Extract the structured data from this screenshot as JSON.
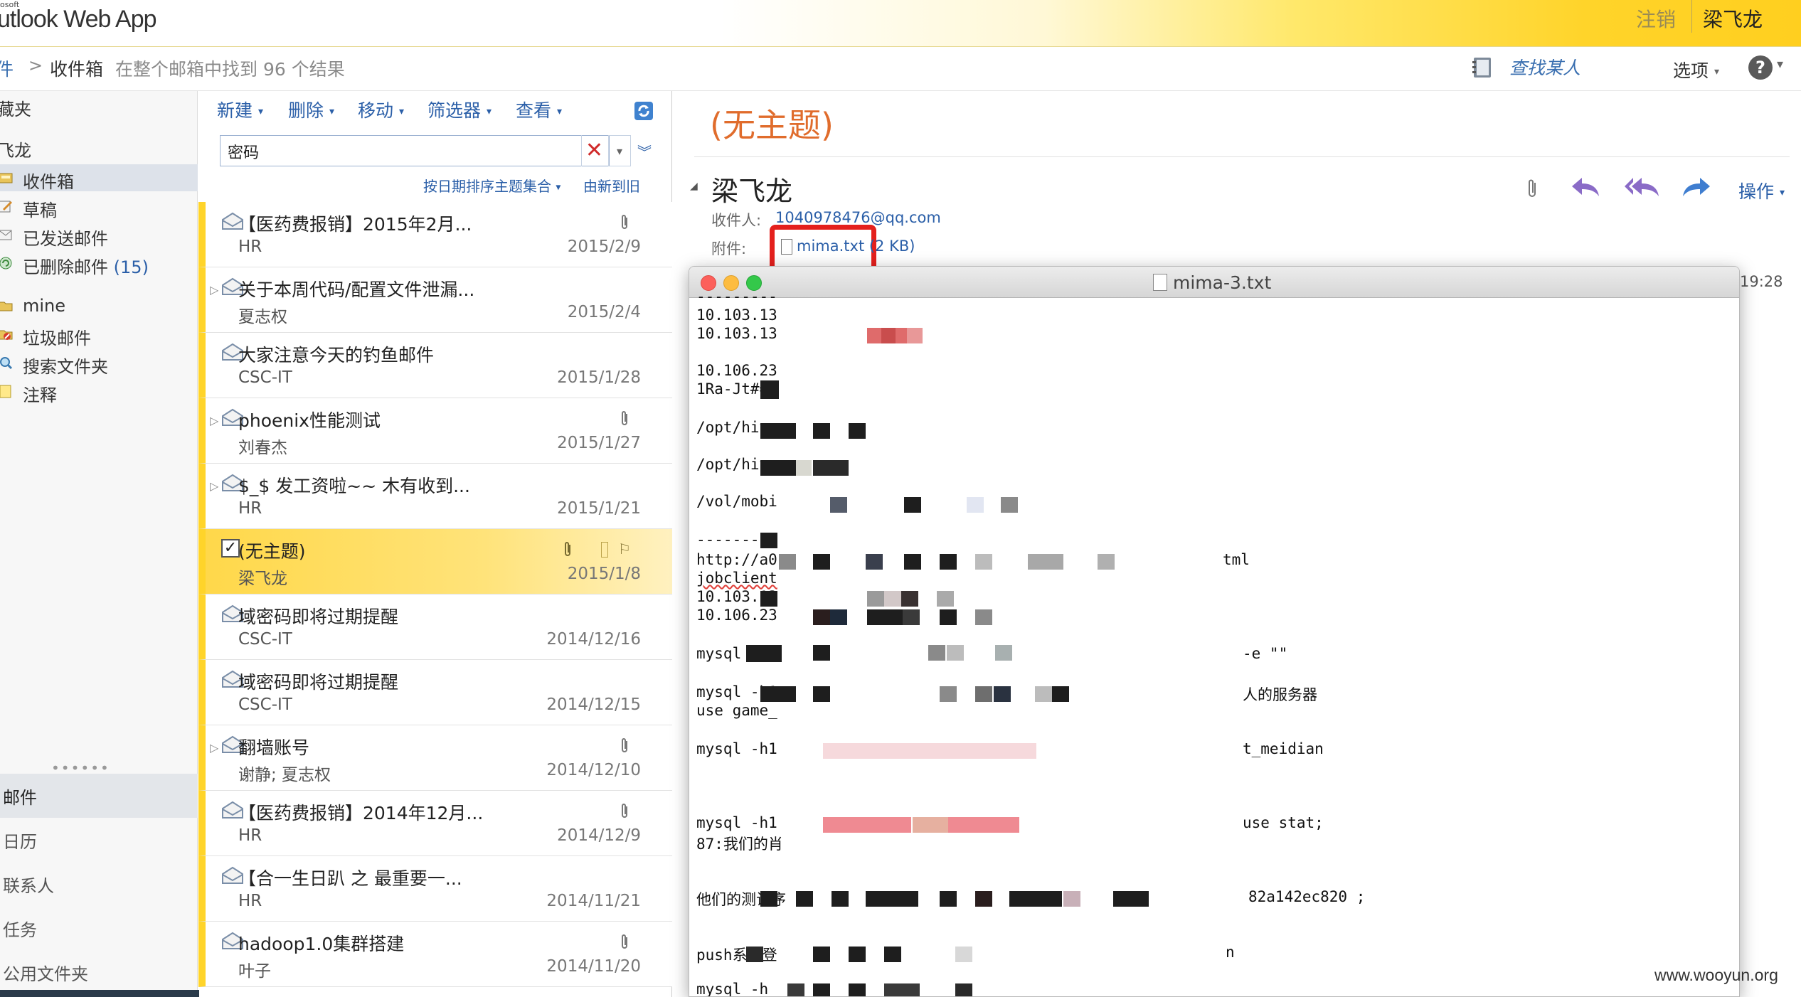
{
  "header": {
    "ms_tag": "osoft",
    "app_title": "utlook Web App",
    "signout": "注销",
    "username": "梁飞龙"
  },
  "breadcrumb": {
    "mail": "件",
    "separator": ">",
    "folder": "收件箱",
    "result": "在整个邮箱中找到 96 个结果",
    "find_person": "查找某人",
    "options": "选项",
    "help": "?"
  },
  "leftnav": {
    "favorites": "藏夹",
    "account": "飞龙",
    "items": [
      {
        "label": "收件箱",
        "icon": "inbox-icon"
      },
      {
        "label": "草稿",
        "icon": "drafts-icon"
      },
      {
        "label": "已发送邮件",
        "icon": "sent-icon"
      },
      {
        "label": "已删除邮件",
        "icon": "deleted-icon",
        "count": "15"
      }
    ],
    "items2": [
      {
        "label": "mine",
        "icon": "folder-icon"
      },
      {
        "label": "垃圾邮件",
        "icon": "junk-icon"
      },
      {
        "label": "搜索文件夹",
        "icon": "search-folder-icon"
      },
      {
        "label": "注释",
        "icon": "notes-icon"
      }
    ],
    "grip": "••••••",
    "sections": {
      "mail": "邮件",
      "calendar": "日历",
      "contacts": "联系人",
      "tasks": "任务",
      "public": "公用文件夹"
    }
  },
  "toolbar": {
    "new": "新建",
    "delete": "删除",
    "move": "移动",
    "filter": "筛选器",
    "view": "查看"
  },
  "search": {
    "value": "密码",
    "sort_label": "按日期排序主题集合",
    "sort_order": "由新到旧"
  },
  "messages": [
    {
      "subject": "【医药费报销】2015年2月...",
      "sender": "HR",
      "date": "2015/2/9"
    },
    {
      "subject": "关于本周代码/配置文件泄漏...",
      "sender": "夏志权",
      "date": "2015/2/4"
    },
    {
      "subject": "大家注意今天的钓鱼邮件",
      "sender": "CSC-IT",
      "date": "2015/1/28"
    },
    {
      "subject": "phoenix性能测试",
      "sender": "刘春杰",
      "date": "2015/1/27"
    },
    {
      "subject": "$_$ 发工资啦~~ 木有收到...",
      "sender": "HR",
      "date": "2015/1/21"
    },
    {
      "subject": "(无主题)",
      "sender": "梁飞龙",
      "date": "2015/1/8"
    },
    {
      "subject": "域密码即将过期提醒",
      "sender": "CSC-IT",
      "date": "2014/12/16"
    },
    {
      "subject": "域密码即将过期提醒",
      "sender": "CSC-IT",
      "date": "2014/12/15"
    },
    {
      "subject": "翻墙账号",
      "sender": "谢静; 夏志权",
      "date": "2014/12/10"
    },
    {
      "subject": "【医药费报销】2014年12月...",
      "sender": "HR",
      "date": "2014/12/9"
    },
    {
      "subject": "【合一生日趴 之 最重要一...",
      "sender": "HR",
      "date": "2014/11/21"
    },
    {
      "subject": "hadoop1.0集群搭建",
      "sender": "叶子",
      "date": "2014/11/20"
    }
  ],
  "reading": {
    "subject": "(无主题)",
    "sender": "梁飞龙",
    "to_label": "收件人:",
    "to_value": "1040978476@qq.com",
    "attachment_label": "附件:",
    "attachment": "mima.txt (2 KB)",
    "time": "19:28",
    "ops": "操作"
  },
  "textfile": {
    "title": "mima-3.txt",
    "lines": [
      "---------",
      "10.103.13",
      "10.103.13",
      "",
      "10.106.23",
      "1Ra-Jt#=8",
      "",
      "/opt/hive",
      "",
      "/opt/hive",
      "",
      "/vol/mobi",
      "",
      "---------",
      "http://a0",
      "jobclient",
      "10.103.13",
      "10.106.23",
      "",
      "mysql -h1",
      "",
      "mysql -h1",
      "use game_",
      "",
      "mysql -h1",
      "",
      "",
      "",
      "mysql -h1",
      "87:我们的肖",
      "",
      "",
      "他们的测试序",
      "",
      "",
      "push系统登",
      "",
      "mysql -h"
    ],
    "right_fragments": {
      "tml": "tml",
      "e_quotes": "-e \"\"",
      "server": "人的服务器",
      "meidian": "t_meidian",
      "use_stat": "use stat;",
      "hash": "82a142ec820 ;",
      "n": "n"
    }
  },
  "watermark": "www.wooyun.org"
}
